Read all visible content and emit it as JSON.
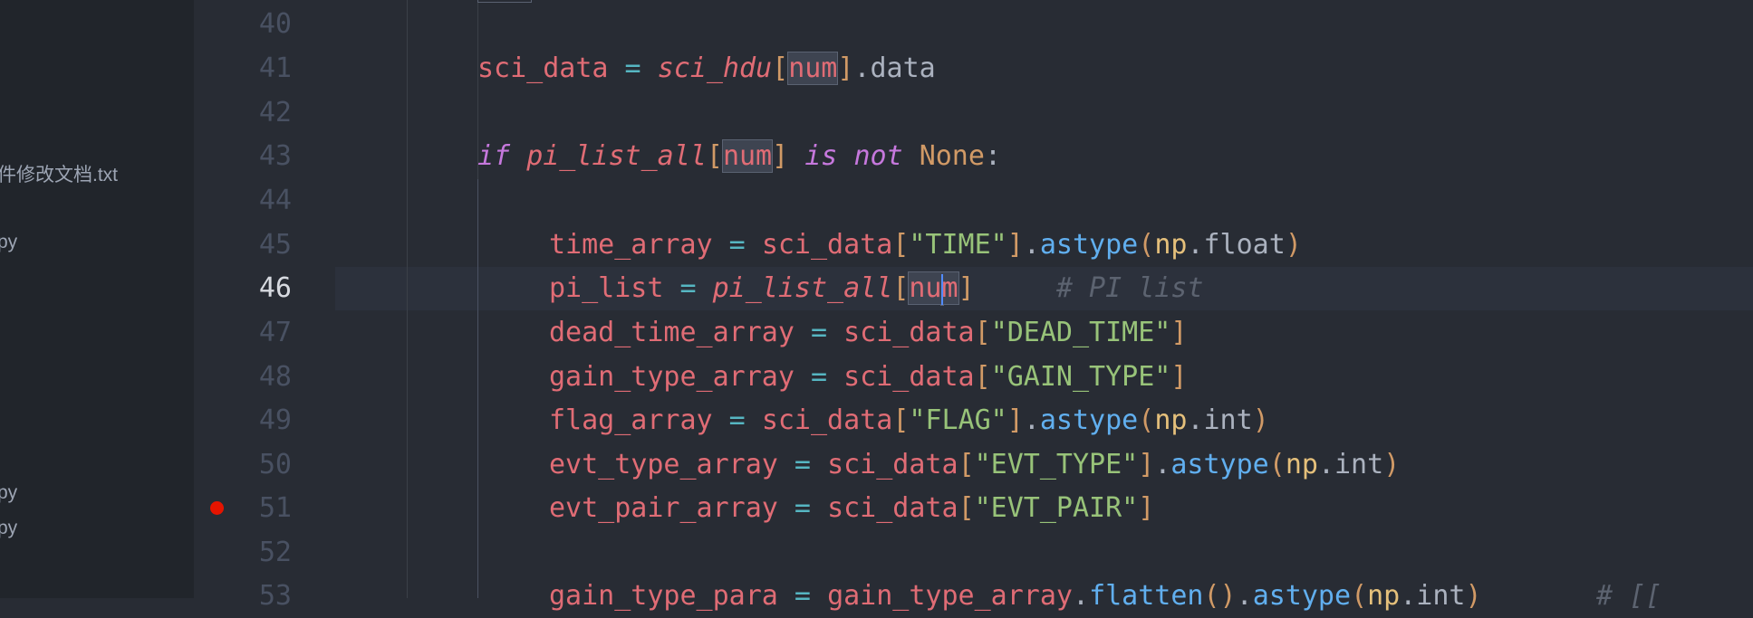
{
  "sidebar": {
    "items": [
      {
        "label": "件修改文档.txt"
      },
      {
        "label": "py"
      },
      {
        "label": "py"
      },
      {
        "label": "py"
      }
    ]
  },
  "gutter": {
    "line_numbers": [
      "40",
      "41",
      "42",
      "43",
      "44",
      "45",
      "46",
      "47",
      "48",
      "49",
      "50",
      "51",
      "52",
      "53"
    ],
    "active_line": "46",
    "breakpoint_line": "51"
  },
  "editor": {
    "selected_word": "num",
    "colors": {
      "background": "#282c34",
      "variable": "#e06c75",
      "keyword": "#c678dd",
      "string": "#98c379",
      "function": "#61afef",
      "comment": "#5c6370",
      "breakpoint": "#e51400"
    },
    "lines": {
      "l41": {
        "v1": "sci_data",
        "eq": " = ",
        "v2": "sci_hdu",
        "b1": "[",
        "sel": "num",
        "b2": "]",
        "rest": ".data"
      },
      "l43": {
        "kw1": "if",
        "v": "pi_list_all",
        "b1": "[",
        "sel": "num",
        "b2": "]",
        "kw2": "is",
        "kw3": "not",
        "none": "None",
        "colon": ":"
      },
      "l45": {
        "v": "time_array",
        "eq": " = ",
        "src": "sci_data",
        "b1": "[",
        "str": "\"TIME\"",
        "b2": "]",
        "dot": ".",
        "fn": "astype",
        "p1": "(",
        "np": "np",
        "attr": ".float",
        "p2": ")"
      },
      "l46": {
        "v": "pi_list",
        "eq": " = ",
        "src": "pi_list_all",
        "b1": "[",
        "sel_a": "nu",
        "sel_b": "m",
        "b2": "]",
        "cm": "# PI list"
      },
      "l47": {
        "v": "dead_time_array",
        "eq": " = ",
        "src": "sci_data",
        "b1": "[",
        "str": "\"DEAD_TIME\"",
        "b2": "]"
      },
      "l48": {
        "v": "gain_type_array",
        "eq": " = ",
        "src": "sci_data",
        "b1": "[",
        "str": "\"GAIN_TYPE\"",
        "b2": "]"
      },
      "l49": {
        "v": "flag_array",
        "eq": " = ",
        "src": "sci_data",
        "b1": "[",
        "str": "\"FLAG\"",
        "b2": "]",
        "dot": ".",
        "fn": "astype",
        "p1": "(",
        "np": "np",
        "attr": ".int",
        "p2": ")"
      },
      "l50": {
        "v": "evt_type_array",
        "eq": " = ",
        "src": "sci_data",
        "b1": "[",
        "str": "\"EVT_TYPE\"",
        "b2": "]",
        "dot": ".",
        "fn": "astype",
        "p1": "(",
        "np": "np",
        "attr": ".int",
        "p2": ")"
      },
      "l51": {
        "v": "evt_pair_array",
        "eq": " = ",
        "src": "sci_data",
        "b1": "[",
        "str": "\"EVT_PAIR\"",
        "b2": "]"
      },
      "l53": {
        "v": "gain_type_para",
        "eq": " = ",
        "src": "gain_type_array",
        "dot1": ".",
        "fn1": "flatten",
        "pp": "()",
        "dot2": ".",
        "fn2": "astype",
        "p1": "(",
        "np": "np",
        "attr": ".int",
        "p2": ")",
        "cm": "# [["
      }
    }
  }
}
